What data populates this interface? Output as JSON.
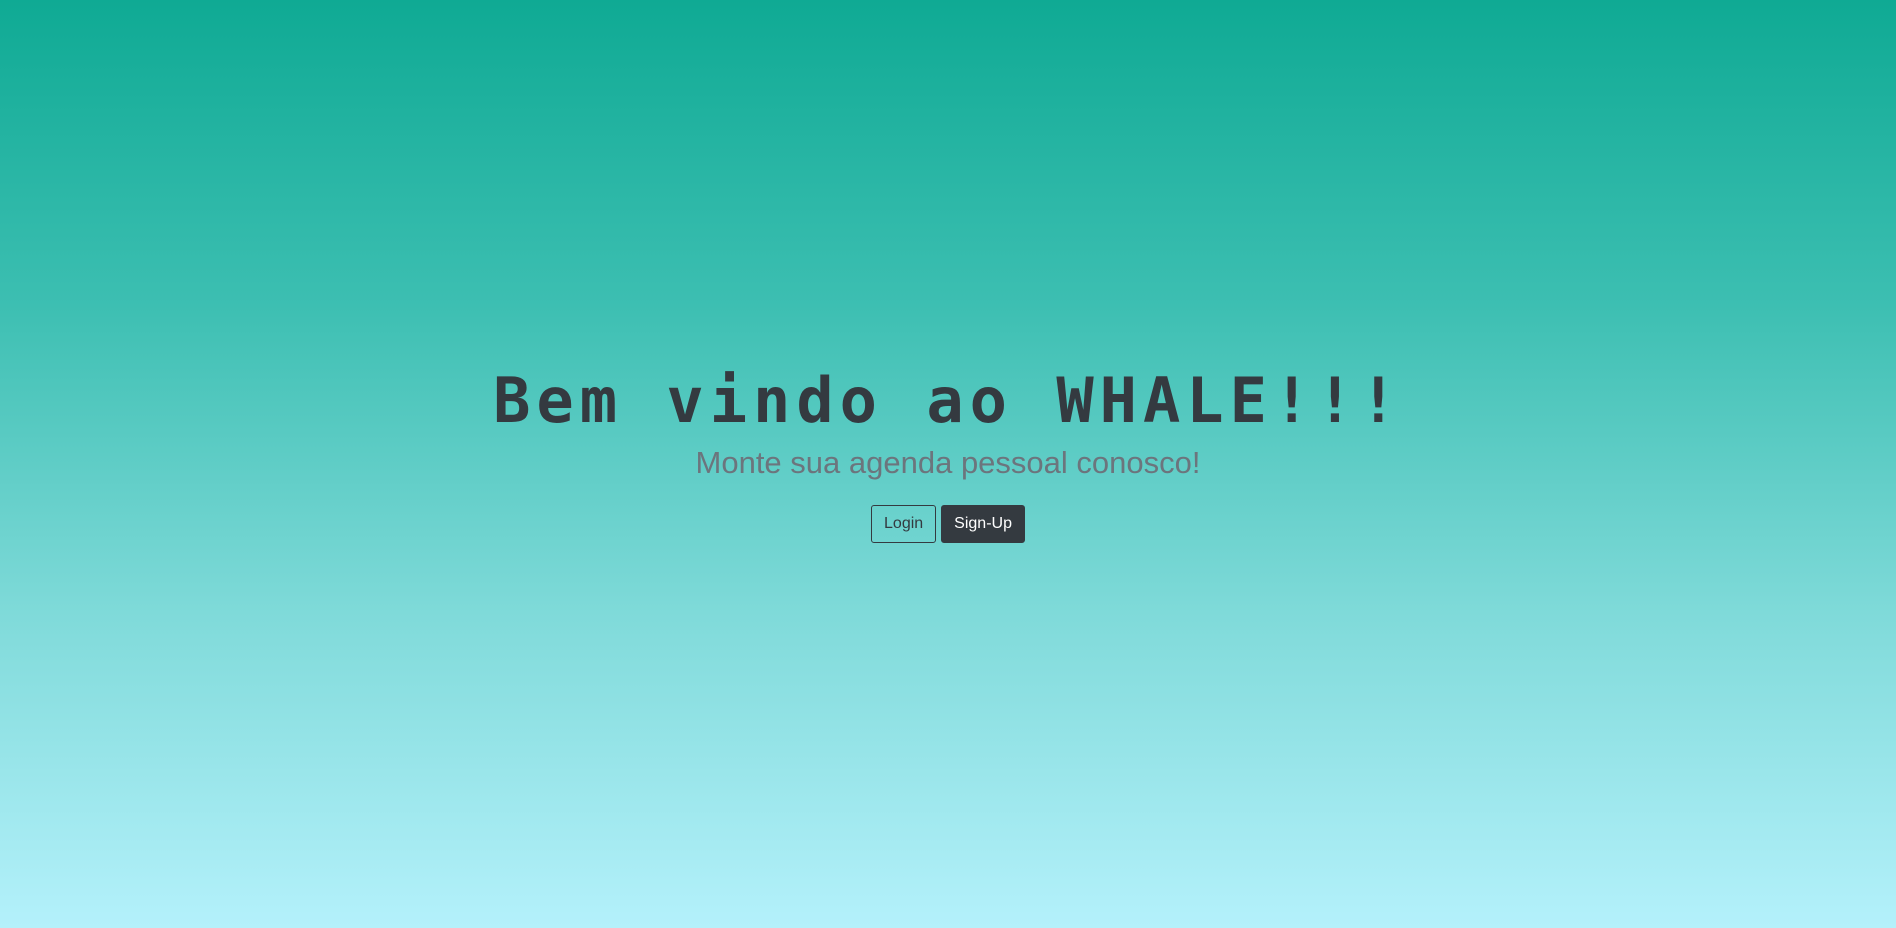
{
  "hero": {
    "title": "Bem vindo ao WHALE!!!",
    "subtitle": "Monte sua agenda pessoal conosco!",
    "login_label": "Login",
    "signup_label": "Sign-Up"
  },
  "colors": {
    "gradient_top": "#0faa94",
    "gradient_bottom": "#b4f1fb",
    "title_color": "#343a40",
    "subtitle_color": "#6c757d",
    "dark_button": "#343a40"
  }
}
